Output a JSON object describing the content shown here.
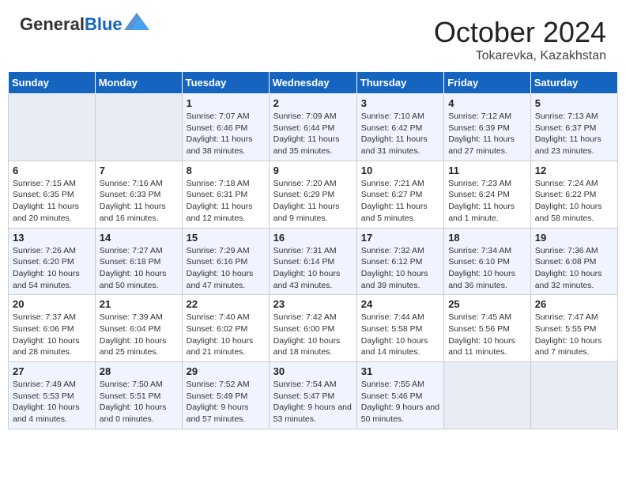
{
  "header": {
    "logo_general": "General",
    "logo_blue": "Blue",
    "month": "October 2024",
    "location": "Tokarevka, Kazakhstan"
  },
  "days_of_week": [
    "Sunday",
    "Monday",
    "Tuesday",
    "Wednesday",
    "Thursday",
    "Friday",
    "Saturday"
  ],
  "weeks": [
    [
      {
        "day": "",
        "sunrise": "",
        "sunset": "",
        "daylight": "",
        "empty": true
      },
      {
        "day": "",
        "sunrise": "",
        "sunset": "",
        "daylight": "",
        "empty": true
      },
      {
        "day": "1",
        "sunrise": "Sunrise: 7:07 AM",
        "sunset": "Sunset: 6:46 PM",
        "daylight": "Daylight: 11 hours and 38 minutes."
      },
      {
        "day": "2",
        "sunrise": "Sunrise: 7:09 AM",
        "sunset": "Sunset: 6:44 PM",
        "daylight": "Daylight: 11 hours and 35 minutes."
      },
      {
        "day": "3",
        "sunrise": "Sunrise: 7:10 AM",
        "sunset": "Sunset: 6:42 PM",
        "daylight": "Daylight: 11 hours and 31 minutes."
      },
      {
        "day": "4",
        "sunrise": "Sunrise: 7:12 AM",
        "sunset": "Sunset: 6:39 PM",
        "daylight": "Daylight: 11 hours and 27 minutes."
      },
      {
        "day": "5",
        "sunrise": "Sunrise: 7:13 AM",
        "sunset": "Sunset: 6:37 PM",
        "daylight": "Daylight: 11 hours and 23 minutes."
      }
    ],
    [
      {
        "day": "6",
        "sunrise": "Sunrise: 7:15 AM",
        "sunset": "Sunset: 6:35 PM",
        "daylight": "Daylight: 11 hours and 20 minutes."
      },
      {
        "day": "7",
        "sunrise": "Sunrise: 7:16 AM",
        "sunset": "Sunset: 6:33 PM",
        "daylight": "Daylight: 11 hours and 16 minutes."
      },
      {
        "day": "8",
        "sunrise": "Sunrise: 7:18 AM",
        "sunset": "Sunset: 6:31 PM",
        "daylight": "Daylight: 11 hours and 12 minutes."
      },
      {
        "day": "9",
        "sunrise": "Sunrise: 7:20 AM",
        "sunset": "Sunset: 6:29 PM",
        "daylight": "Daylight: 11 hours and 9 minutes."
      },
      {
        "day": "10",
        "sunrise": "Sunrise: 7:21 AM",
        "sunset": "Sunset: 6:27 PM",
        "daylight": "Daylight: 11 hours and 5 minutes."
      },
      {
        "day": "11",
        "sunrise": "Sunrise: 7:23 AM",
        "sunset": "Sunset: 6:24 PM",
        "daylight": "Daylight: 11 hours and 1 minute."
      },
      {
        "day": "12",
        "sunrise": "Sunrise: 7:24 AM",
        "sunset": "Sunset: 6:22 PM",
        "daylight": "Daylight: 10 hours and 58 minutes."
      }
    ],
    [
      {
        "day": "13",
        "sunrise": "Sunrise: 7:26 AM",
        "sunset": "Sunset: 6:20 PM",
        "daylight": "Daylight: 10 hours and 54 minutes."
      },
      {
        "day": "14",
        "sunrise": "Sunrise: 7:27 AM",
        "sunset": "Sunset: 6:18 PM",
        "daylight": "Daylight: 10 hours and 50 minutes."
      },
      {
        "day": "15",
        "sunrise": "Sunrise: 7:29 AM",
        "sunset": "Sunset: 6:16 PM",
        "daylight": "Daylight: 10 hours and 47 minutes."
      },
      {
        "day": "16",
        "sunrise": "Sunrise: 7:31 AM",
        "sunset": "Sunset: 6:14 PM",
        "daylight": "Daylight: 10 hours and 43 minutes."
      },
      {
        "day": "17",
        "sunrise": "Sunrise: 7:32 AM",
        "sunset": "Sunset: 6:12 PM",
        "daylight": "Daylight: 10 hours and 39 minutes."
      },
      {
        "day": "18",
        "sunrise": "Sunrise: 7:34 AM",
        "sunset": "Sunset: 6:10 PM",
        "daylight": "Daylight: 10 hours and 36 minutes."
      },
      {
        "day": "19",
        "sunrise": "Sunrise: 7:36 AM",
        "sunset": "Sunset: 6:08 PM",
        "daylight": "Daylight: 10 hours and 32 minutes."
      }
    ],
    [
      {
        "day": "20",
        "sunrise": "Sunrise: 7:37 AM",
        "sunset": "Sunset: 6:06 PM",
        "daylight": "Daylight: 10 hours and 28 minutes."
      },
      {
        "day": "21",
        "sunrise": "Sunrise: 7:39 AM",
        "sunset": "Sunset: 6:04 PM",
        "daylight": "Daylight: 10 hours and 25 minutes."
      },
      {
        "day": "22",
        "sunrise": "Sunrise: 7:40 AM",
        "sunset": "Sunset: 6:02 PM",
        "daylight": "Daylight: 10 hours and 21 minutes."
      },
      {
        "day": "23",
        "sunrise": "Sunrise: 7:42 AM",
        "sunset": "Sunset: 6:00 PM",
        "daylight": "Daylight: 10 hours and 18 minutes."
      },
      {
        "day": "24",
        "sunrise": "Sunrise: 7:44 AM",
        "sunset": "Sunset: 5:58 PM",
        "daylight": "Daylight: 10 hours and 14 minutes."
      },
      {
        "day": "25",
        "sunrise": "Sunrise: 7:45 AM",
        "sunset": "Sunset: 5:56 PM",
        "daylight": "Daylight: 10 hours and 11 minutes."
      },
      {
        "day": "26",
        "sunrise": "Sunrise: 7:47 AM",
        "sunset": "Sunset: 5:55 PM",
        "daylight": "Daylight: 10 hours and 7 minutes."
      }
    ],
    [
      {
        "day": "27",
        "sunrise": "Sunrise: 7:49 AM",
        "sunset": "Sunset: 5:53 PM",
        "daylight": "Daylight: 10 hours and 4 minutes."
      },
      {
        "day": "28",
        "sunrise": "Sunrise: 7:50 AM",
        "sunset": "Sunset: 5:51 PM",
        "daylight": "Daylight: 10 hours and 0 minutes."
      },
      {
        "day": "29",
        "sunrise": "Sunrise: 7:52 AM",
        "sunset": "Sunset: 5:49 PM",
        "daylight": "Daylight: 9 hours and 57 minutes."
      },
      {
        "day": "30",
        "sunrise": "Sunrise: 7:54 AM",
        "sunset": "Sunset: 5:47 PM",
        "daylight": "Daylight: 9 hours and 53 minutes."
      },
      {
        "day": "31",
        "sunrise": "Sunrise: 7:55 AM",
        "sunset": "Sunset: 5:46 PM",
        "daylight": "Daylight: 9 hours and 50 minutes."
      },
      {
        "day": "",
        "sunrise": "",
        "sunset": "",
        "daylight": "",
        "empty": true
      },
      {
        "day": "",
        "sunrise": "",
        "sunset": "",
        "daylight": "",
        "empty": true
      }
    ]
  ]
}
